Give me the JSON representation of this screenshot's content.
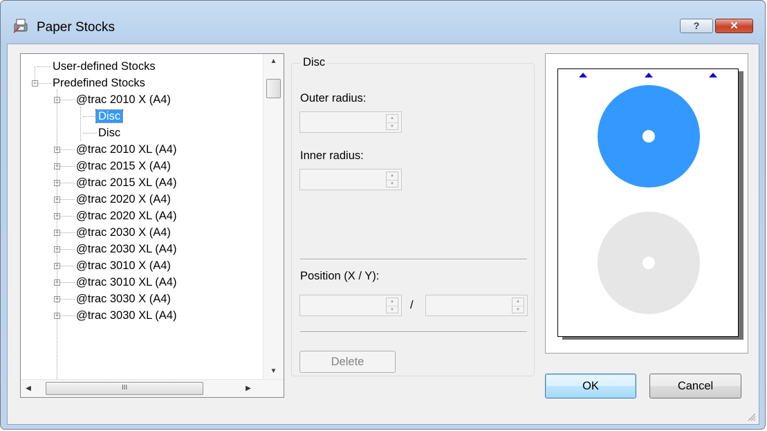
{
  "window": {
    "title": "Paper Stocks",
    "help_label": "?",
    "close_label": "✕"
  },
  "tree": {
    "nodes": [
      {
        "label": "User-defined Stocks",
        "level": 0,
        "expander": "none"
      },
      {
        "label": "Predefined Stocks",
        "level": 0,
        "expander": "minus"
      },
      {
        "label": "@trac 2010 X (A4)",
        "level": 1,
        "expander": "minus"
      },
      {
        "label": "Disc",
        "level": 2,
        "expander": "none",
        "selected": true
      },
      {
        "label": "Disc",
        "level": 2,
        "expander": "none"
      },
      {
        "label": "@trac 2010 XL (A4)",
        "level": 1,
        "expander": "plus"
      },
      {
        "label": "@trac 2015 X (A4)",
        "level": 1,
        "expander": "plus"
      },
      {
        "label": "@trac 2015 XL (A4)",
        "level": 1,
        "expander": "plus"
      },
      {
        "label": "@trac 2020 X (A4)",
        "level": 1,
        "expander": "plus"
      },
      {
        "label": "@trac 2020 XL (A4)",
        "level": 1,
        "expander": "plus"
      },
      {
        "label": "@trac 2030 X (A4)",
        "level": 1,
        "expander": "plus"
      },
      {
        "label": "@trac 2030 XL (A4)",
        "level": 1,
        "expander": "plus"
      },
      {
        "label": "@trac 3010 X (A4)",
        "level": 1,
        "expander": "plus"
      },
      {
        "label": "@trac 3010 XL (A4)",
        "level": 1,
        "expander": "plus"
      },
      {
        "label": "@trac 3030 X (A4)",
        "level": 1,
        "expander": "plus"
      },
      {
        "label": "@trac 3030 XL (A4)",
        "level": 1,
        "expander": "plus"
      }
    ],
    "hscroll_thumb_label": "III"
  },
  "disc_group": {
    "title": "Disc",
    "outer_radius_label": "Outer radius:",
    "outer_radius_value": "",
    "inner_radius_label": "Inner radius:",
    "inner_radius_value": "",
    "position_label": "Position (X / Y):",
    "position_x_value": "",
    "position_y_value": "",
    "separator": "/",
    "delete_label": "Delete"
  },
  "buttons": {
    "ok_label": "OK",
    "cancel_label": "Cancel"
  },
  "preview": {
    "selected_disc_color": "#3399ff",
    "other_disc_color": "#e6e6e6",
    "marker_color": "#1010c8"
  }
}
